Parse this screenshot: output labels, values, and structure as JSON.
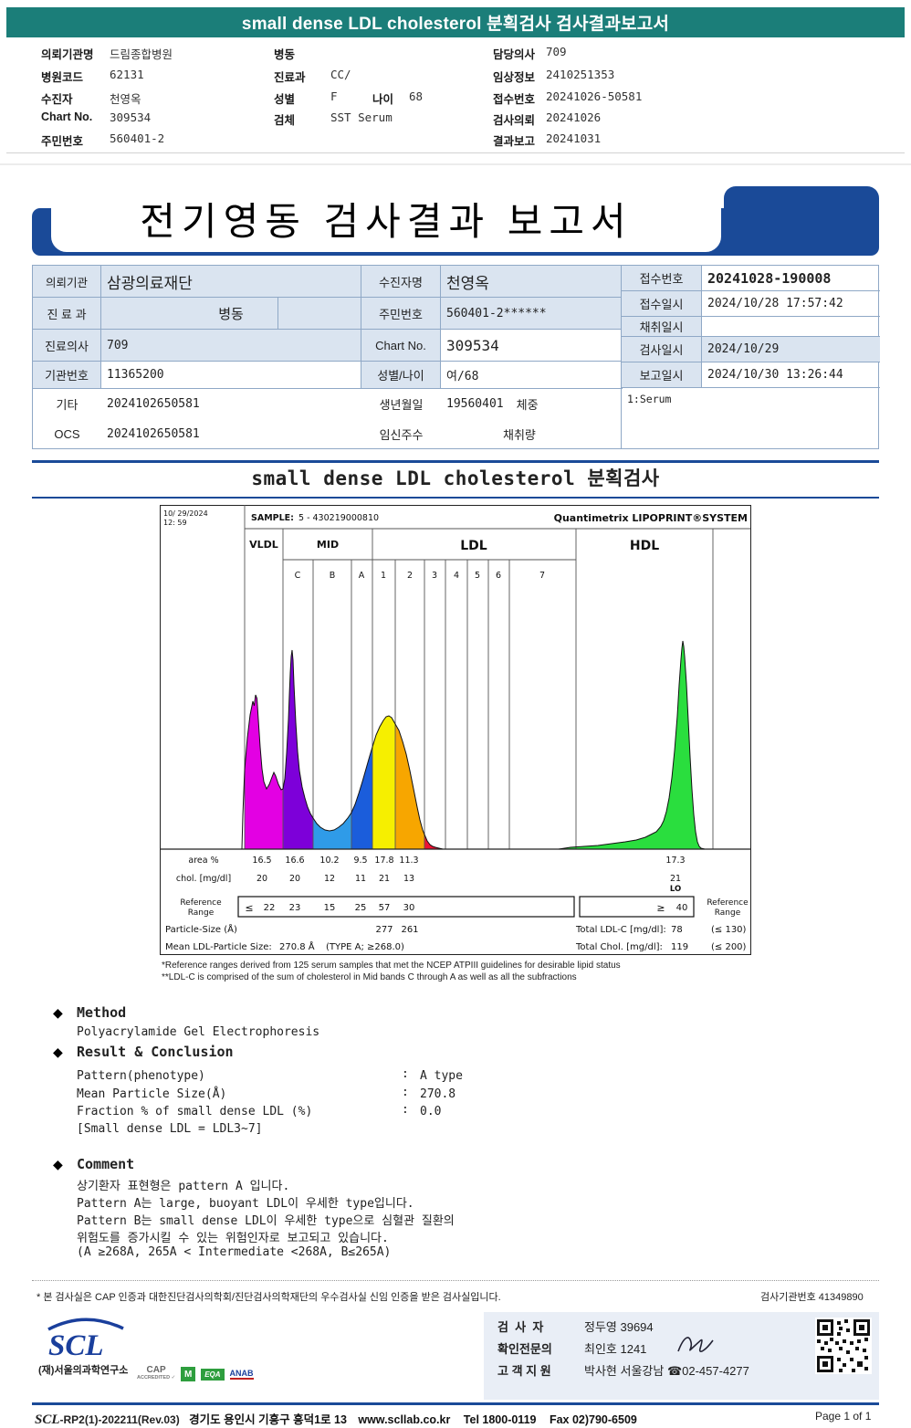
{
  "colors": {
    "teal_bar": "#1b7e79",
    "banner_blue": "#1a4a98",
    "rule_blue": "#1a4a98",
    "table_border": "#8fa8c6",
    "cell_bg": "#dae4f0",
    "brand_magenta": "#e800d0",
    "lo_red": "#cc4433",
    "scl_blue": "#1a3f9c",
    "vldl": "#e300e3",
    "mid_c": "#7d00d9",
    "mid_b": "#2f9be8",
    "mid_a": "#1b5ddb",
    "ldl_1": "#f6ef00",
    "ldl_2": "#f7a600",
    "ldl_3": "#ee1133",
    "hdl": "#2ade3e"
  },
  "icons": {
    "diamond": "◆"
  },
  "top_bar": {
    "title": "small dense LDL cholesterol 분획검사 검사결과보고서"
  },
  "patient_header": {
    "col1": [
      {
        "label": "의뢰기관명",
        "value": "드림종합병원"
      },
      {
        "label": "병원코드",
        "value": "62131"
      },
      {
        "label": "수진자",
        "value": "천영옥"
      },
      {
        "label": "Chart No.",
        "value": "309534"
      },
      {
        "label": "주민번호",
        "value": "560401-2"
      }
    ],
    "col2": [
      {
        "label": "병동",
        "value": ""
      },
      {
        "label": "진료과",
        "value": "CC/"
      },
      {
        "label": "성별",
        "value": "F",
        "label2": "나이",
        "value2": "68"
      },
      {
        "label": "검체",
        "value": "SST Serum"
      }
    ],
    "col3": [
      {
        "label": "담당의사",
        "value": "709"
      },
      {
        "label": "임상정보",
        "value": "2410251353"
      },
      {
        "label": "접수번호",
        "value": "20241026-50581"
      },
      {
        "label": "검사의뢰",
        "value": "20241026"
      },
      {
        "label": "결과보고",
        "value": "20241031"
      }
    ]
  },
  "banner": {
    "title": "전기영동 검사결과 보고서"
  },
  "info_table": {
    "rows_left": [
      {
        "l1": "의뢰기관",
        "v1": "삼광의료재단",
        "l2": "수진자명",
        "v2": "천영옥"
      },
      {
        "l1": "진 료 과",
        "v1": "병동",
        "l2": "주민번호",
        "v2": "560401-2******"
      },
      {
        "l1": "진료의사",
        "v1": "709",
        "l2": "Chart No.",
        "v2": "309534"
      },
      {
        "l1": "기관번호",
        "v1": "11365200",
        "l2": "성별/나이",
        "v2": "여/68"
      },
      {
        "l1": "기타",
        "v1": "2024102650581",
        "l2": "생년월일",
        "v2": "19560401",
        "l3": "체중"
      },
      {
        "l1": "OCS",
        "v1": "2024102650581",
        "l2": "임신주수",
        "v2": "",
        "l3": "채취량"
      }
    ],
    "rows_right": [
      {
        "label": "접수번호",
        "value": "20241028-190008"
      },
      {
        "label": "접수일시",
        "value": "2024/10/28 17:57:42"
      },
      {
        "label": "채취일시",
        "value": ""
      },
      {
        "label": "검사일시",
        "value": "2024/10/29"
      },
      {
        "label": "보고일시",
        "value": "2024/10/30 13:26:44"
      }
    ],
    "serum_note": "1:Serum"
  },
  "section_title": "small dense LDL cholesterol 분획검사",
  "chart_data": {
    "type": "area",
    "title": "Quantimetrix LIPOPRINT®SYSTEM",
    "datetime_line1": "10/ 29/2024",
    "datetime_line2": "12: 59",
    "sample_label": "SAMPLE:",
    "sample_id": "5 - 430219000810",
    "sections": [
      "VLDL",
      "MID",
      "LDL",
      "HDL"
    ],
    "mid_subbands": [
      "C",
      "B",
      "A"
    ],
    "ldl_subbands": [
      "1",
      "2",
      "3",
      "4",
      "5",
      "6",
      "7"
    ],
    "row_labels": {
      "area": "area %",
      "chol": "chol. [mg/dl]",
      "ref1": "Reference",
      "ref2": "Range"
    },
    "fractions": [
      {
        "name": "VLDL",
        "area_pct": 16.5,
        "chol": 20,
        "ref": 22
      },
      {
        "name": "MID C",
        "area_pct": 16.6,
        "chol": 20,
        "ref": 23
      },
      {
        "name": "MID B",
        "area_pct": 10.2,
        "chol": 12,
        "ref": 15
      },
      {
        "name": "MID A",
        "area_pct": 9.5,
        "chol": 11,
        "ref": 25
      },
      {
        "name": "LDL 1",
        "area_pct": 17.8,
        "chol": 21,
        "ref": 57
      },
      {
        "name": "LDL 2",
        "area_pct": 11.3,
        "chol": 13,
        "ref": 30
      },
      {
        "name": "HDL",
        "area_pct": 17.3,
        "chol": 21,
        "flag": "LO",
        "ref": 40
      }
    ],
    "ref_le_sign": "≤",
    "ref_ge_sign": "≥",
    "particle_size_label": "Particle-Size (Å)",
    "particle_sizes": {
      "ldl1": 277,
      "ldl2": 261
    },
    "mean_particle_label": "Mean LDL-Particle Size:",
    "mean_particle_size": "270.8 Å",
    "mean_particle_type": "(TYPE A; ≥268.0)",
    "total_ldl_label": "Total LDL-C [mg/dl]:",
    "total_ldl": 78,
    "total_ldl_ref": "(≤ 130)",
    "total_chol_label": "Total Chol. [mg/dl]:",
    "total_chol": 119,
    "total_chol_ref": "(≤ 200)"
  },
  "footnotes": [
    "*Reference ranges derived from 125 serum samples that met the NCEP ATPIII guidelines for desirable lipid status",
    "**LDL-C is comprised of the sum of cholesterol in Mid bands C through A as well as all the subfractions"
  ],
  "method": {
    "heading": "Method",
    "body": "Polyacrylamide Gel Electrophoresis",
    "result_heading": "Result & Conclusion",
    "colon": ":",
    "items": [
      {
        "label": "Pattern(phenotype)",
        "value": "A type"
      },
      {
        "label": "Mean Particle Size(Å)",
        "value": "270.8"
      },
      {
        "label": "Fraction % of small dense LDL (%)",
        "value": "0.0"
      }
    ],
    "note": "[Small dense LDL = LDL3~7]"
  },
  "comment": {
    "heading": "Comment",
    "lines": [
      "상기환자 표현형은 pattern A 입니다.",
      "Pattern A는 large, buoyant LDL이 우세한 type입니다.",
      "Pattern B는 small dense LDL이 우세한 type으로 심혈관 질환의",
      "위험도를 증가시킬 수 있는 위험인자로 보고되고 있습니다.",
      "(A ≥268A, 265A < Intermediate <268A, B≤265A)"
    ]
  },
  "certification": {
    "text": "* 본 검사실은 CAP 인증과 대한진단검사의학회/진단검사의학재단의 우수검사실 신임 인증을 받은 검사실입니다.",
    "org_label": "검사기관번호",
    "org_no": "41349890"
  },
  "staff": {
    "rows": [
      {
        "label": "검  사  자",
        "value": "정두영 39694"
      },
      {
        "label": "확인전문의",
        "value": "최인호 1241"
      },
      {
        "label": "고 객 지 원",
        "value": "박사현 서울강남 ☎02-457-4277"
      }
    ]
  },
  "logos": {
    "scl": "SCL",
    "scl_sub": "(재)서울의과학연구소",
    "cap1": "CAP",
    "cap2": "ACCREDITED ✓",
    "lm": "M",
    "eqa": "EQA",
    "anab": "ANAB"
  },
  "bottom": {
    "doc_scl": "SCL",
    "doc_code": "-RP2(1)-202211(Rev.03)",
    "address": "경기도 용인시 기흥구 흥덕1로 13",
    "website": "www.scllab.co.kr",
    "tel": "Tel 1800-0119",
    "fax": "Fax 02)790-6509",
    "page": "Page 1 of 1"
  }
}
